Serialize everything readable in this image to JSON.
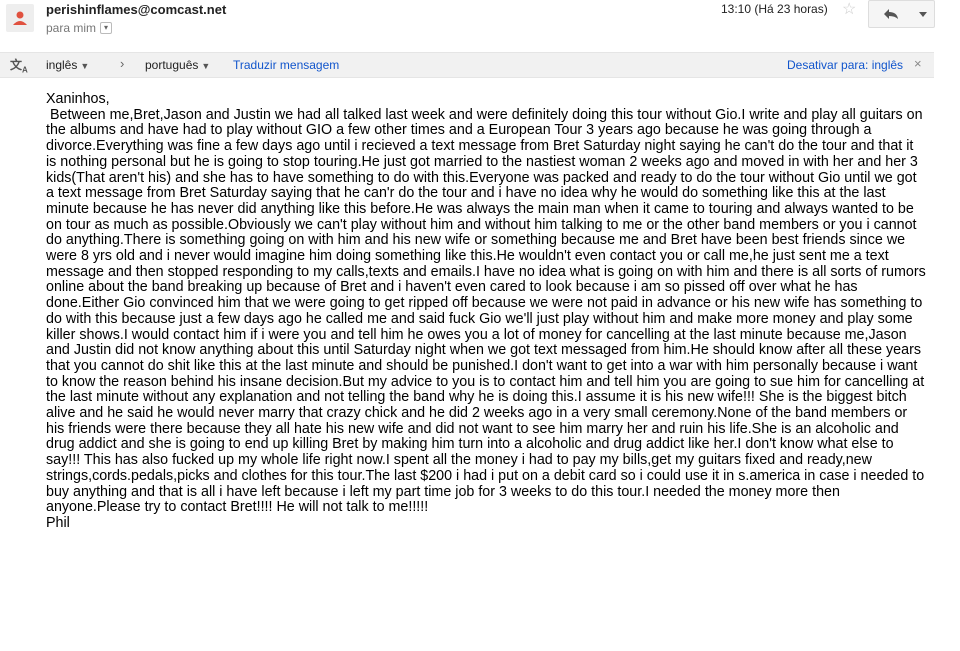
{
  "header": {
    "sender": "perishinflames@comcast.net",
    "recipient": "para mim",
    "time": "13:10 (Há 23 horas)"
  },
  "translation_bar": {
    "source_language": "inglês",
    "target_language": "português",
    "translate_link": "Traduzir mensagem",
    "disable_link": "Desativar para: inglês"
  },
  "message": {
    "greeting": "Xaninhos,",
    "paragraph": " Between me,Bret,Jason and Justin we had all talked last week and were definitely doing this tour without Gio.I write and play all guitars on the albums and have had to play without GIO a few other times and a European Tour 3 years ago because he was going through a divorce.Everything was fine a few days ago until i recieved a text message from Bret Saturday night saying he can't do the tour and that it is nothing personal but he is going to stop touring.He just got married to the nastiest woman 2 weeks ago and moved in with her and her 3 kids(That aren't his) and she has to have something to do with this.Everyone was packed and ready to do the tour without Gio until we got a text message from Bret Saturday saying that he can'r do the tour and i have no idea why he would do something like this at the last minute because he has never did anything like this before.He was always the main man when it came to touring and always wanted to be on tour as much as possible.Obviously we can't play without him and without him talking to me or the other band members or you i cannot do anything.There is something going on with him and his new wife or something because me and Bret have been best friends since we were 8 yrs old and i never would imagine him doing something like this.He wouldn't even contact you or call me,he just sent me a text message and then stopped responding to my calls,texts and emails.I have no idea what is going on with him and there is all sorts of rumors online about the band breaking up because of Bret and i haven't even cared to look because i am so pissed off over what he has done.Either Gio convinced him that we were going to get ripped off because we were not paid in advance or his new wife has something to do with this because just a few days ago he called me and said fuck Gio we'll just play without him and make more money and play some killer shows.I would contact him if i were you and tell him he owes you a lot of money for cancelling at the last minute because me,Jason and Justin did not know anything about this until Saturday night when we got text messaged from him.He should know after all these years that you cannot do shit like this at the last minute and should be punished.I don't want to get into a war with him personally because i want to know the reason behind his insane decision.But my advice to you is to contact him and tell him you are going to sue him for cancelling at the last minute without any explanation and not telling the band why he is doing this.I assume it is his new wife!!! She is the biggest bitch alive and he said he would never marry that crazy chick and he did 2 weeks ago in a very small ceremony.None of the band members or his friends were there because they all hate his new wife and did not want to see him marry her and ruin his life.She is an alcoholic and drug addict and she is going to end up killing Bret by making him turn into a alcoholic and drug addict like her.I don't know what else to say!!! This has also fucked up my whole life right now.I spent all the money i had to pay my bills,get my guitars fixed and ready,new strings,cords.pedals,picks and clothes for this tour.The last $200 i had i put on a debit card so i could use it in s.america in case i needed to buy anything and that is all i have left because i left my part time job for 3 weeks to do this tour.I needed the money more then anyone.Please try to contact Bret!!!! He will not talk to me!!!!!",
    "signature": "Phil"
  }
}
